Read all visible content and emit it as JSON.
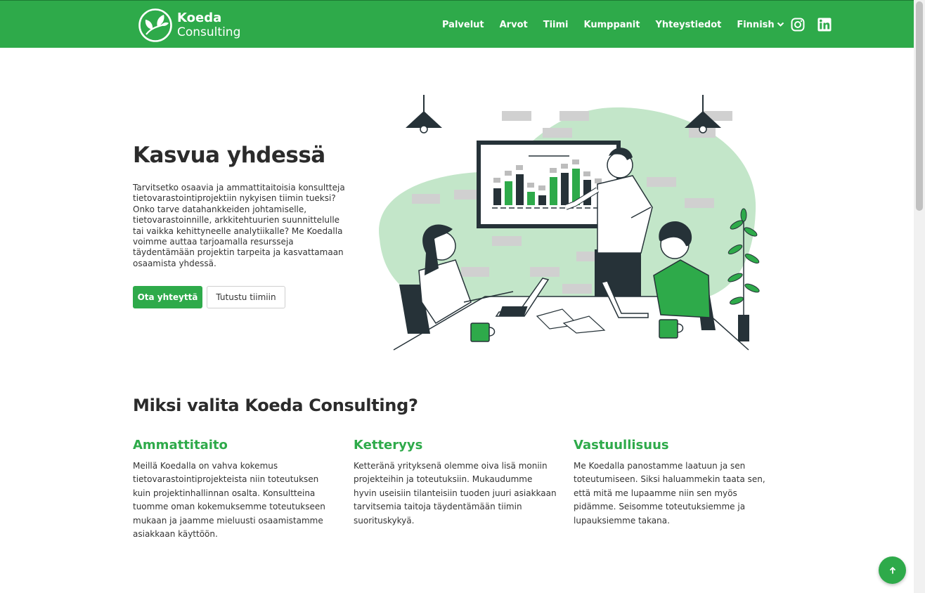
{
  "brand": {
    "name_line1": "Koeda",
    "name_line2": "Consulting",
    "color": "#2eaa4a"
  },
  "nav": {
    "items": [
      {
        "label": "Palvelut"
      },
      {
        "label": "Arvot"
      },
      {
        "label": "Tiimi"
      },
      {
        "label": "Kumppanit"
      },
      {
        "label": "Yhteystiedot"
      }
    ],
    "language": "Finnish",
    "social": [
      "instagram-icon",
      "linkedin-icon"
    ]
  },
  "hero": {
    "title": "Kasvua yhdessä",
    "text": "Tarvitsetko osaavia ja ammattitaitoisia konsultteja tietovarastointiprojektiin nykyisen tiimin tueksi? Onko tarve datahankkeiden johtamiselle, tietovarastoinnille, arkkitehtuurien suunnittelulle tai vaikka kehittyneelle analytiikalle? Me Koedalla voimme auttaa tarjoamalla resursseja täydentämään projektin tarpeita ja kasvattamaan osaamista yhdessä.",
    "primary_button": "Ota yhteyttä",
    "secondary_button": "Tutustu tiimiin",
    "illustration": "team-meeting-illustration"
  },
  "why": {
    "title": "Miksi valita Koeda Consulting?",
    "features": [
      {
        "title": "Ammattitaito",
        "text": "Meillä Koedalla on vahva kokemus tietovarastointiprojekteista niin toteutuksen kuin projektinhallinnan osalta. Konsultteina tuomme oman kokemuksemme toteutukseen mukaan ja jaamme mieluusti osaamistamme asiakkaan käyttöön."
      },
      {
        "title": "Ketteryys",
        "text": "Ketteränä yrityksenä olemme oiva lisä moniin projekteihin ja toteutuksiin. Mukaudumme hyvin useisiin tilanteisiin tuoden juuri asiakkaan tarvitsemia taitoja täydentämään tiimin suorituskykyä."
      },
      {
        "title": "Vastuullisuus",
        "text": "Me Koedalla panostamme laatuun ja sen toteutumiseen. Siksi haluammekin taata sen, että mitä me lupaamme niin sen myös pidämme. Seisomme toteutuksiemme ja lupauksiemme takana."
      }
    ]
  },
  "back_to_top_icon": "arrow-up-icon"
}
